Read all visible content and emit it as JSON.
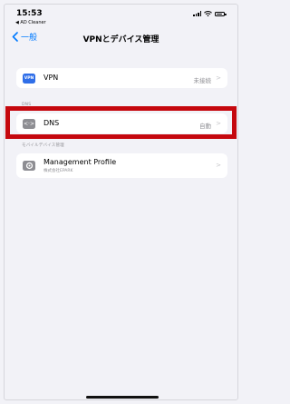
{
  "status_bar": {
    "time": "15:53",
    "back_app": "◀ AD Cleaner"
  },
  "nav": {
    "back_label": "一般",
    "title": "VPNとデバイス管理"
  },
  "vpn_row": {
    "icon_text": "VPN",
    "label": "VPN",
    "value": "未接続"
  },
  "dns_section": {
    "header": "DNS"
  },
  "dns_row": {
    "icon_text": "<·>",
    "label": "DNS",
    "value": "自動"
  },
  "profile_section": {
    "header": "モバイルデバイス管理"
  },
  "profile_row": {
    "label": "Management Profile",
    "sublabel": "株式会社EPARK"
  },
  "chevron": ">",
  "colors": {
    "accent": "#007aff",
    "highlight": "#c5080e",
    "vpn_icon": "#2f6ee8",
    "gray_icon": "#8e8e93"
  }
}
